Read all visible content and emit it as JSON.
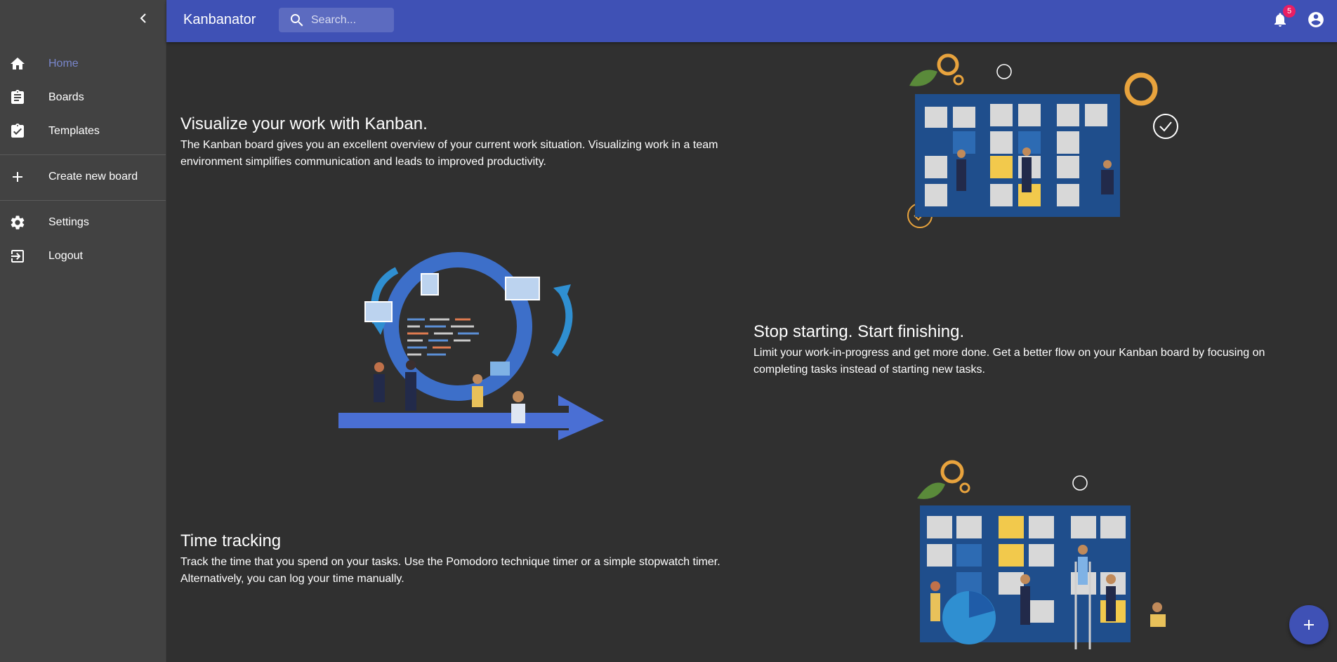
{
  "app": {
    "title": "Kanbanator"
  },
  "search": {
    "placeholder": "Search..."
  },
  "notifications": {
    "count": "5"
  },
  "sidebar": {
    "items": [
      {
        "label": "Home",
        "icon": "home-icon",
        "active": true
      },
      {
        "label": "Boards",
        "icon": "clipboard-icon"
      },
      {
        "label": "Templates",
        "icon": "clipboard-check-icon"
      },
      {
        "label": "Create new board",
        "icon": "plus-icon"
      },
      {
        "label": "Settings",
        "icon": "gear-icon"
      },
      {
        "label": "Logout",
        "icon": "logout-icon"
      }
    ]
  },
  "features": [
    {
      "title": "Visualize your work with Kanban.",
      "text": "The Kanban board gives you an excellent overview of your current work situation. Visualizing work in a team environment simplifies communication and leads to improved productivity."
    },
    {
      "title": "Stop starting. Start finishing.",
      "text": "Limit your work-in-progress and get more done. Get a better flow on your Kanban board by focusing on completing tasks instead of starting new tasks."
    },
    {
      "title": "Time tracking",
      "text": "Track the time that you spend on your tasks. Use the Pomodoro technique timer or a simple stopwatch timer. Alternatively, you can log your time manually."
    }
  ],
  "colors": {
    "primary": "#3f51b5",
    "sidebar_bg": "#424242",
    "content_bg": "#303030",
    "active_nav": "#7986cb",
    "badge": "#e91e63",
    "accent_orange": "#e8a33d",
    "board_blue": "#1f4e8c"
  }
}
